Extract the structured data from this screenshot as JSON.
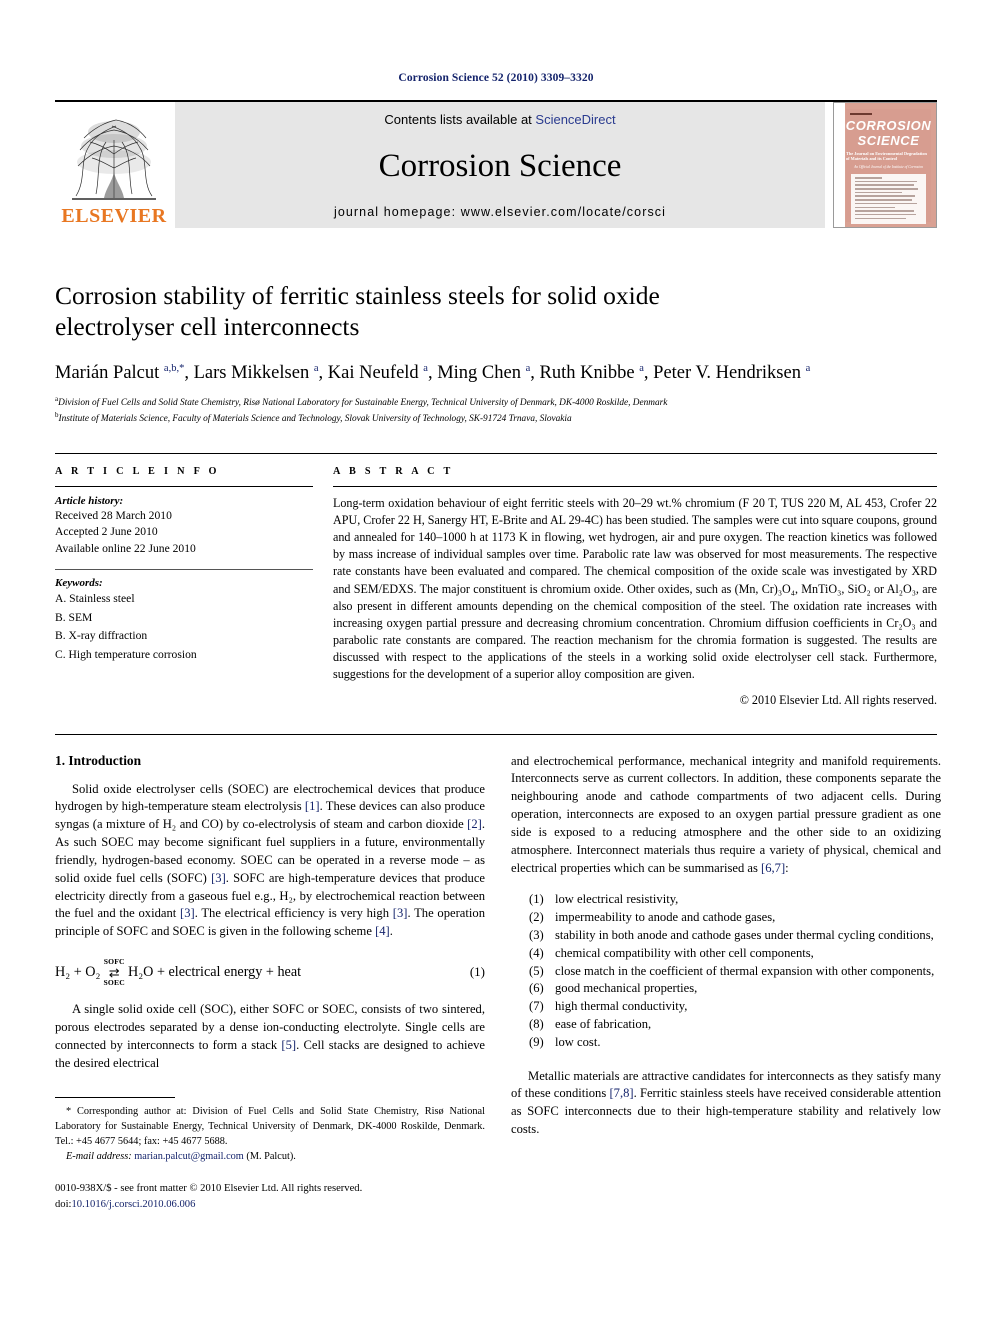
{
  "running_head": "Corrosion Science 52 (2010) 3309–3320",
  "masthead": {
    "publisher": "ELSEVIER",
    "contents_prefix": "Contents lists available at ",
    "contents_link": "ScienceDirect",
    "journal_title": "Corrosion Science",
    "homepage": "journal homepage: www.elsevier.com/locate/corsci",
    "cover": {
      "line1": "CORROSION",
      "line2": "SCIENCE",
      "subtitle": "The Journal on Environmental Degradation of Materials and its Control",
      "subtitle2": "An Official Journal of the Institute of Corrosion",
      "contents_word": "CONTENTS"
    }
  },
  "article": {
    "title": "Corrosion stability of ferritic stainless steels for solid oxide electrolyser cell interconnects",
    "authors_html": "Marián Palcut <sup>a,b,</sup><sup>*</sup>, Lars Mikkelsen <sup>a</sup>, Kai Neufeld <sup>a</sup>, Ming Chen <sup>a</sup>, Ruth Knibbe <sup>a</sup>, Peter V. Hendriksen <sup>a</sup>",
    "affiliations": [
      "Division of Fuel Cells and Solid State Chemistry, Risø National Laboratory for Sustainable Energy, Technical University of Denmark, DK-4000 Roskilde, Denmark",
      "Institute of Materials Science, Faculty of Materials Science and Technology, Slovak University of Technology, SK-91724 Trnava, Slovakia"
    ],
    "affiliation_marks": [
      "a",
      "b"
    ]
  },
  "article_info": {
    "heading": "A R T I C L E     I N F O",
    "history_label": "Article history:",
    "history": [
      "Received 28 March 2010",
      "Accepted 2 June 2010",
      "Available online 22 June 2010"
    ],
    "keywords_label": "Keywords:",
    "keywords": [
      "A. Stainless steel",
      "B. SEM",
      "B. X-ray diffraction",
      "C. High temperature corrosion"
    ]
  },
  "abstract": {
    "heading": "A B S T R A C T",
    "text": "Long-term oxidation behaviour of eight ferritic steels with 20–29 wt.% chromium (F 20 T, TUS 220 M, AL 453, Crofer 22 APU, Crofer 22 H, Sanergy HT, E-Brite and AL 29-4C) has been studied. The samples were cut into square coupons, ground and annealed for 140–1000 h at 1173 K in flowing, wet hydrogen, air and pure oxygen. The reaction kinetics was followed by mass increase of individual samples over time. Parabolic rate law was observed for most measurements. The respective rate constants have been evaluated and compared. The chemical composition of the oxide scale was investigated by XRD and SEM/EDXS. The major constituent is chromium oxide. Other oxides, such as (Mn, Cr)₃O₄, MnTiO₃, SiO₂ or Al₂O₃, are also present in different amounts depending on the chemical composition of the steel. The oxidation rate increases with increasing oxygen partial pressure and decreasing chromium concentration. Chromium diffusion coefficients in Cr₂O₃ and parabolic rate constants are compared. The reaction mechanism for the chromia formation is suggested. The results are discussed with respect to the applications of the steels in a working solid oxide electrolyser cell stack. Furthermore, suggestions for the development of a superior alloy composition are given.",
    "copyright": "© 2010 Elsevier Ltd. All rights reserved."
  },
  "body": {
    "section_title": "1. Introduction",
    "left_paragraphs": [
      "Solid oxide electrolyser cells (SOEC) are electrochemical devices that produce hydrogen by high-temperature steam electrolysis [1]. These devices can also produce syngas (a mixture of H₂ and CO) by co-electrolysis of steam and carbon dioxide [2]. As such SOEC may become significant fuel suppliers in a future, environmentally friendly, hydrogen-based economy. SOEC can be operated in a reverse mode – as solid oxide fuel cells (SOFC) [3]. SOFC are high-temperature devices that produce electricity directly from a gaseous fuel e.g., H₂, by electrochemical reaction between the fuel and the oxidant [3]. The electrical efficiency is very high [3]. The operation principle of SOFC and SOEC is given in the following scheme [4].",
      "A single solid oxide cell (SOC), either SOFC or SOEC, consists of two sintered, porous electrodes separated by a dense ion-conducting electrolyte. Single cells are connected by interconnects to form a stack [5]. Cell stacks are designed to achieve the desired electrical"
    ],
    "equation": {
      "left": "H₂ + O₂",
      "arrow_top": "SOFC",
      "arrow_glyph": "⇄",
      "arrow_bottom": "SOEC",
      "right": "H₂O + electrical energy + heat",
      "number": "(1)"
    },
    "right_paragraphs": [
      "and electrochemical performance, mechanical integrity and manifold requirements. Interconnects serve as current collectors. In addition, these components separate the neighbouring anode and cathode compartments of two adjacent cells. During operation, interconnects are exposed to an oxygen partial pressure gradient as one side is exposed to a reducing atmosphere and the other side to an oxidizing atmosphere. Interconnect materials thus require a variety of physical, chemical and electrical properties which can be summarised as [6,7]:"
    ],
    "requirements": [
      {
        "num": "(1)",
        "text": "low electrical resistivity,"
      },
      {
        "num": "(2)",
        "text": "impermeability to anode and cathode gases,"
      },
      {
        "num": "(3)",
        "text": "stability in both anode and cathode gases under thermal cycling conditions,"
      },
      {
        "num": "(4)",
        "text": "chemical compatibility with other cell components,"
      },
      {
        "num": "(5)",
        "text": "close match in the coefficient of thermal expansion with other components,"
      },
      {
        "num": "(6)",
        "text": "good mechanical properties,"
      },
      {
        "num": "(7)",
        "text": "high thermal conductivity,"
      },
      {
        "num": "(8)",
        "text": "ease of fabrication,"
      },
      {
        "num": "(9)",
        "text": "low cost."
      }
    ],
    "right_paragraphs_after": [
      "Metallic materials are attractive candidates for interconnects as they satisfy many of these conditions [7,8]. Ferritic stainless steels have received considerable attention as SOFC interconnects due to their high-temperature stability and relatively low costs."
    ]
  },
  "footnote": {
    "corresponding": "* Corresponding author at: Division of Fuel Cells and Solid State Chemistry, Risø National Laboratory for Sustainable Energy, Technical University of Denmark, DK-4000 Roskilde, Denmark. Tel.: +45 4677 5644; fax: +45 4677 5688.",
    "email_label": "E-mail address:",
    "email": "marian.palcut@gmail.com",
    "email_suffix": "(M. Palcut)."
  },
  "imprint": {
    "issn_line": "0010-938X/$ - see front matter © 2010 Elsevier Ltd. All rights reserved.",
    "doi_label": "doi:",
    "doi": "10.1016/j.corsci.2010.06.006"
  },
  "colors": {
    "link_blue": "#14236b",
    "elsevier_orange": "#E87722",
    "banner_grey": "#e6e6e6",
    "cover_salmon": "#d79d90"
  }
}
